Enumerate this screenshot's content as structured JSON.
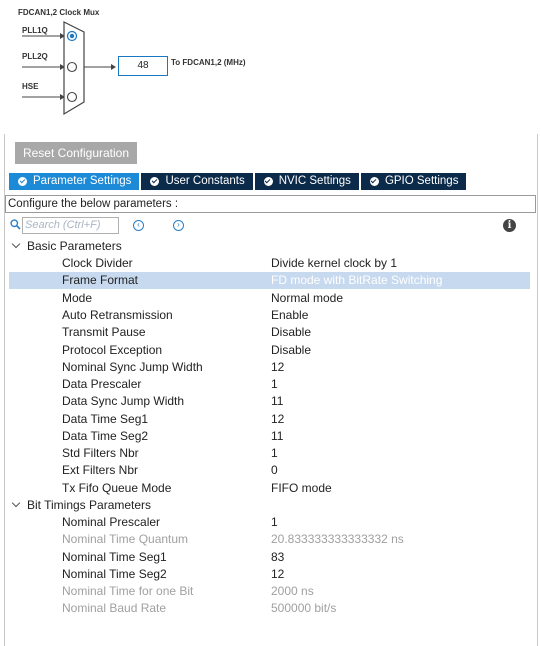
{
  "mux": {
    "title": "FDCAN1,2 Clock Mux",
    "sources": [
      "PLL1Q",
      "PLL2Q",
      "HSE"
    ],
    "output_value": "48",
    "output_label": "To FDCAN1,2 (MHz)"
  },
  "panel": {
    "reset_label": "Reset Configuration",
    "tabs": [
      {
        "label": "Parameter Settings",
        "active": true
      },
      {
        "label": "User Constants",
        "active": false
      },
      {
        "label": "NVIC Settings",
        "active": false
      },
      {
        "label": "GPIO Settings",
        "active": false
      }
    ],
    "config_text": "Configure the below parameters :",
    "search_placeholder": "Search (Ctrl+F)"
  },
  "groups": [
    {
      "label": "Basic Parameters",
      "params": [
        {
          "name": "Clock Divider",
          "value": "Divide kernel clock by 1"
        },
        {
          "name": "Frame Format",
          "value": "FD mode with BitRate Switching",
          "selected": true
        },
        {
          "name": "Mode",
          "value": "Normal mode"
        },
        {
          "name": "Auto Retransmission",
          "value": "Enable"
        },
        {
          "name": "Transmit Pause",
          "value": "Disable"
        },
        {
          "name": "Protocol Exception",
          "value": "Disable"
        },
        {
          "name": "Nominal Sync Jump Width",
          "value": "12"
        },
        {
          "name": "Data Prescaler",
          "value": "1"
        },
        {
          "name": "Data Sync Jump Width",
          "value": "11"
        },
        {
          "name": "Data Time Seg1",
          "value": "12"
        },
        {
          "name": "Data Time Seg2",
          "value": "11"
        },
        {
          "name": "Std Filters Nbr",
          "value": "1"
        },
        {
          "name": "Ext Filters Nbr",
          "value": "0"
        },
        {
          "name": "Tx Fifo Queue Mode",
          "value": "FIFO mode"
        }
      ]
    },
    {
      "label": "Bit Timings Parameters",
      "params": [
        {
          "name": "Nominal Prescaler",
          "value": "1"
        },
        {
          "name": "Nominal Time Quantum",
          "value": "20.833333333333332 ns",
          "disabled": true
        },
        {
          "name": "Nominal Time Seg1",
          "value": "83"
        },
        {
          "name": "Nominal Time Seg2",
          "value": "12"
        },
        {
          "name": "Nominal Time for one Bit",
          "value": "2000 ns",
          "disabled": true
        },
        {
          "name": "Nominal Baud Rate",
          "value": "500000 bit/s",
          "disabled": true
        }
      ]
    }
  ],
  "colors": {
    "accent": "#1d8ad8",
    "tab_dark": "#0c2a4a",
    "selection": "#c7d9ee",
    "mux_blue": "#1a78c2"
  }
}
